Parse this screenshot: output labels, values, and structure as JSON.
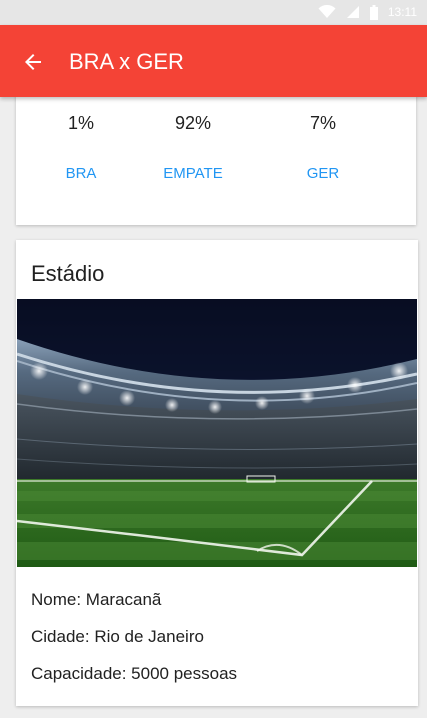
{
  "status_bar": {
    "time": "13:11"
  },
  "toolbar": {
    "title": "BRA x GER"
  },
  "odds": [
    {
      "value": "1%",
      "label": "BRA"
    },
    {
      "value": "92%",
      "label": "EMPATE"
    },
    {
      "value": "7%",
      "label": "GER"
    }
  ],
  "stadium": {
    "title": "Estádio",
    "name_line": "Nome: Maracanã",
    "city_line": "Cidade: Rio de Janeiro",
    "capacity_line": "Capacidade: 5000 pessoas"
  },
  "colors": {
    "toolbar": "#f44336",
    "accent": "#2196f3"
  },
  "icons": {
    "back": "arrow-left-icon",
    "wifi": "wifi-icon",
    "signal": "signal-icon",
    "battery": "battery-icon"
  }
}
